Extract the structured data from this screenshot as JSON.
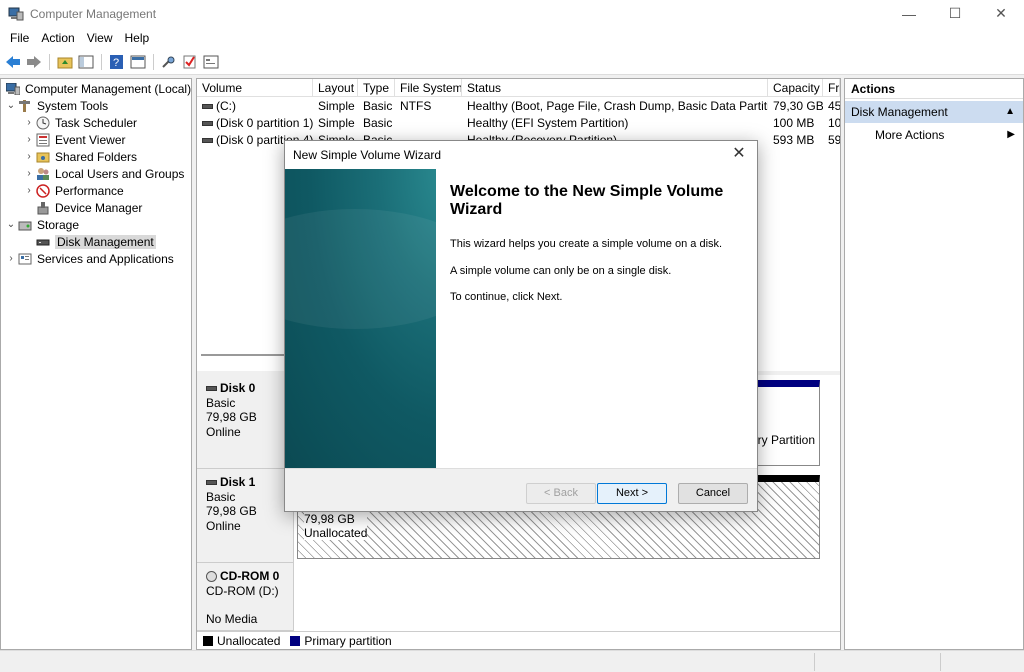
{
  "window": {
    "title": "Computer Management",
    "minimize": "—",
    "maximize": "☐",
    "close": "✕"
  },
  "menu": [
    "File",
    "Action",
    "View",
    "Help"
  ],
  "tree": {
    "root": "Computer Management (Local)",
    "system_tools": "System Tools",
    "task_scheduler": "Task Scheduler",
    "event_viewer": "Event Viewer",
    "shared_folders": "Shared Folders",
    "local_users": "Local Users and Groups",
    "performance": "Performance",
    "device_manager": "Device Manager",
    "storage": "Storage",
    "disk_management": "Disk Management",
    "services": "Services and Applications"
  },
  "volumes": {
    "headers": [
      "Volume",
      "Layout",
      "Type",
      "File System",
      "Status",
      "Capacity",
      "Fr"
    ],
    "rows": [
      [
        "(C:)",
        "Simple",
        "Basic",
        "NTFS",
        "Healthy (Boot, Page File, Crash Dump, Basic Data Partition)",
        "79,30 GB",
        "45"
      ],
      [
        "(Disk 0 partition 1)",
        "Simple",
        "Basic",
        "",
        "Healthy (EFI System Partition)",
        "100 MB",
        "10"
      ],
      [
        "(Disk 0 partition 4)",
        "Simple",
        "Basic",
        "",
        "Healthy (Recovery Partition)",
        "593 MB",
        "59"
      ]
    ]
  },
  "disks": {
    "disk0": {
      "name": "Disk 0",
      "type": "Basic",
      "size": "79,98 GB",
      "status": "Online",
      "partition_text": "ry Partition"
    },
    "disk1": {
      "name": "Disk 1",
      "type": "Basic",
      "size": "79,98 GB",
      "status": "Online",
      "part_size": "79,98 GB",
      "part_status": "Unallocated"
    },
    "cdrom": {
      "name": "CD-ROM 0",
      "type": "CD-ROM (D:)",
      "status": "No Media"
    }
  },
  "legend": {
    "unallocated": "Unallocated",
    "primary": "Primary partition",
    "unallocated_color": "#000000",
    "primary_color": "#000080"
  },
  "actions": {
    "title": "Actions",
    "section": "Disk Management",
    "more": "More Actions"
  },
  "wizard": {
    "title": "New Simple Volume Wizard",
    "close": "✕",
    "heading": "Welcome to the New Simple Volume Wizard",
    "p1": "This wizard helps you create a simple volume on a disk.",
    "p2": "A simple volume can only be on a single disk.",
    "p3": "To continue, click Next.",
    "back": "< Back",
    "next": "Next >",
    "cancel": "Cancel"
  }
}
